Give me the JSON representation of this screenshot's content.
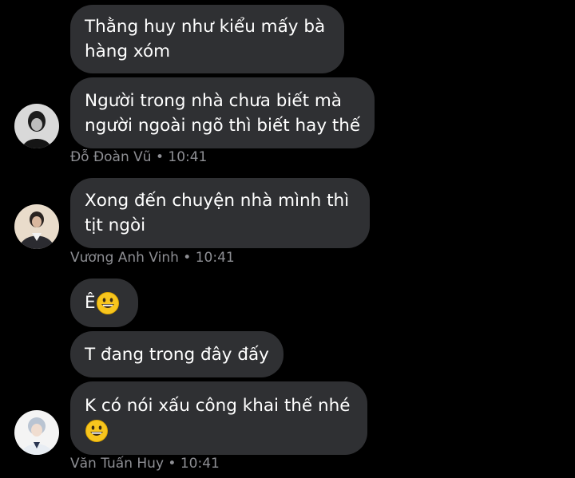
{
  "messages": [
    {
      "text_lines": [
        "Thằng huy như kiểu mấy bà",
        "hàng xóm"
      ]
    },
    {
      "text_lines": [
        "Người trong nhà chưa biết mà",
        "người ngoài ngõ thì biết hay thế"
      ]
    },
    {
      "text_lines": [
        "Xong đến chuyện nhà mình thì",
        "tịt ngòi"
      ]
    },
    {
      "text": "Ê"
    },
    {
      "text": "T đang trong đây đấy"
    },
    {
      "text": "K có nói xấu công khai thế nhé"
    }
  ],
  "senders": [
    {
      "meta": "Đỗ Đoàn Vũ • 10:41",
      "avatar": "avatar-photo"
    },
    {
      "meta": "Vương Anh Vinh • 10:41",
      "avatar": "avatar-photo"
    },
    {
      "meta": "Văn Tuấn Huy • 10:41",
      "avatar": "avatar-photo"
    }
  ],
  "icons": {
    "emoji": "grinning-face-icon"
  },
  "colors": {
    "background": "#000000",
    "bubble": "#2f3033",
    "meta_text": "#8e8f94",
    "message_text": "#ffffff"
  }
}
